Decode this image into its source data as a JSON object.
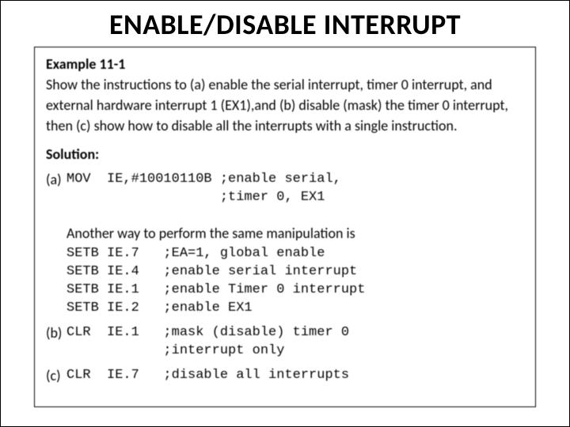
{
  "title": "ENABLE/DISABLE INTERRUPT",
  "example_label": "Example 11-1",
  "prompt_text": "Show the instructions to (a) enable the serial interrupt, timer 0 interrupt, and external hardware interrupt 1 (EX1),and (b) disable (mask) the timer 0 interrupt, then (c) show how to disable all the interrupts with a single instruction.",
  "solution_label": "Solution:",
  "parts": {
    "a": {
      "label": "(a)",
      "code": "MOV  IE,#10010110B ;enable serial,\n                   ;timer 0, EX1"
    },
    "interline": "Another way to perform the same manipulation is",
    "a_alt": {
      "code": "SETB IE.7   ;EA=1, global enable\nSETB IE.4   ;enable serial interrupt\nSETB IE.1   ;enable Timer 0 interrupt\nSETB IE.2   ;enable EX1"
    },
    "b": {
      "label": "(b)",
      "code": "CLR  IE.1   ;mask (disable) timer 0\n            ;interrupt only"
    },
    "c": {
      "label": "(c)",
      "code": "CLR  IE.7   ;disable all interrupts"
    }
  }
}
